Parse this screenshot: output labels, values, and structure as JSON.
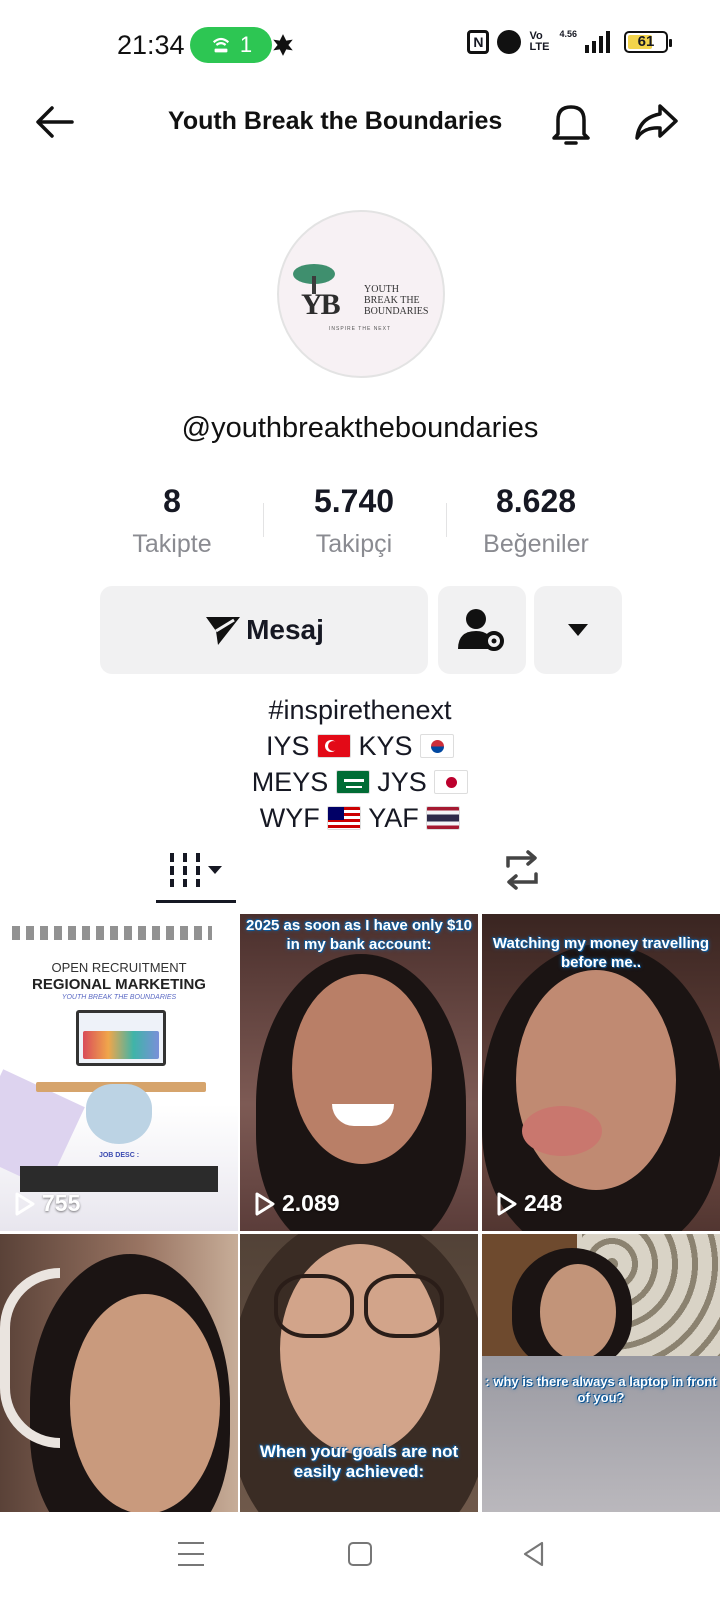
{
  "status_bar": {
    "time": "21:34",
    "hotspot_count": "1",
    "network": "4.56",
    "volte": "Vo LTE",
    "battery": "61",
    "icons": [
      "hotspot-icon",
      "leaf-icon",
      "nfc-icon",
      "alarm-icon",
      "signal-icon",
      "battery-icon"
    ]
  },
  "header": {
    "title": "Youth Break the Boundaries",
    "icons": [
      "back-arrow-icon",
      "bell-icon",
      "share-icon"
    ]
  },
  "profile": {
    "avatar_logo_text": [
      "YOUTH",
      "BREAK THE",
      "BOUNDARIES"
    ],
    "avatar_logo_mark": "YB",
    "avatar_logo_tagline": "INSPIRE THE NEXT",
    "username": "@youthbreaktheboundaries",
    "stats": [
      {
        "value": "8",
        "label": "Takipte"
      },
      {
        "value": "5.740",
        "label": "Takipçi"
      },
      {
        "value": "8.628",
        "label": "Beğeniler"
      }
    ],
    "message_button": "Mesaj",
    "bio": {
      "line1": "#inspirethenext",
      "iys": "IYS",
      "kys": "KYS",
      "meys": "MEYS",
      "jys": "JYS",
      "wyf": "WYF",
      "yaf": "YAF"
    }
  },
  "tabs": {
    "icons": [
      "grid-icon",
      "repost-icon"
    ]
  },
  "videos": [
    {
      "views": "755",
      "poster_line1": "OPEN RECRUITMENT",
      "poster_line2": "REGIONAL MARKETING",
      "poster_line3": "YOUTH BREAK THE BOUNDARIES",
      "poster_jobdesc": "JOB DESC :"
    },
    {
      "views": "2.089",
      "caption": "2025 as soon as I have only $10 in my bank account:"
    },
    {
      "views": "248",
      "caption": "Watching my money travelling before me.."
    },
    {
      "views": "",
      "caption": ""
    },
    {
      "views": "",
      "caption": "When your goals are not easily achieved:"
    },
    {
      "views": "",
      "caption": ": why is there always a laptop in front of you?"
    }
  ],
  "colors": {
    "text": "#161823",
    "muted": "#8a8b91",
    "button_bg": "#f1f1f2",
    "hotspot_green": "#2dc653"
  }
}
